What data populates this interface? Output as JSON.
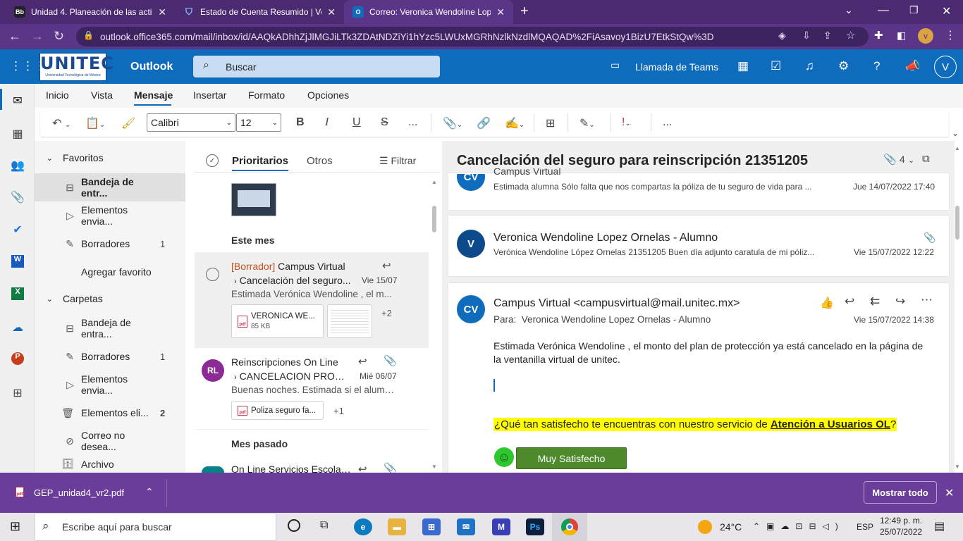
{
  "browser": {
    "tabs": [
      {
        "favicon": "Bb",
        "title": "Unidad 4. Planeación de las activ"
      },
      {
        "favicon": "shield",
        "title": "Estado de Cuenta Resumido | Ver"
      },
      {
        "favicon": "O",
        "title": "Correo: Veronica Wendoline Lop"
      }
    ],
    "new_tab": "+",
    "url": "outlook.office365.com/mail/inbox/id/AAQkADhhZjJlMGJiLTk3ZDAtNDZiYi1hYzc5LWUxMGRhNzlkNzdlMQAQAD%2FiAsavoy1BizU7EtkStQw%3D",
    "profile_initial": "v"
  },
  "outlook": {
    "logo_text": "UNITEC",
    "logo_sub": "Universidad Tecnológica de México",
    "app_name": "Outlook",
    "search_placeholder": "Buscar",
    "teams_call": "Llamada de Teams",
    "avatar": "V"
  },
  "ribbon": {
    "tabs": [
      "Inicio",
      "Vista",
      "Mensaje",
      "Insertar",
      "Formato",
      "Opciones"
    ],
    "active_tab": "Mensaje",
    "font_name": "Calibri",
    "font_size": "12",
    "more": "...",
    "more2": "..."
  },
  "folders": {
    "favoritos_label": "Favoritos",
    "favoritos": [
      {
        "label": "Bandeja de entr...",
        "count": "",
        "icon": "inbox-icon"
      },
      {
        "label": "Elementos envia...",
        "count": "",
        "icon": "send-icon"
      },
      {
        "label": "Borradores",
        "count": "1",
        "icon": "draft-icon"
      },
      {
        "label": "Agregar favorito",
        "count": "",
        "icon": ""
      }
    ],
    "carpetas_label": "Carpetas",
    "carpetas": [
      {
        "label": "Bandeja de entra...",
        "count": "",
        "icon": "inbox-icon"
      },
      {
        "label": "Borradores",
        "count": "1",
        "icon": "draft-icon"
      },
      {
        "label": "Elementos envia...",
        "count": "",
        "icon": "send-icon"
      },
      {
        "label": "Elementos eli...",
        "count": "2",
        "icon": "trash-icon"
      },
      {
        "label": "Correo no desea...",
        "count": "",
        "icon": "junk-icon"
      },
      {
        "label": "Archivo",
        "count": "",
        "icon": "archive-icon"
      }
    ]
  },
  "message_list": {
    "tab_focused": "Prioritarios",
    "tab_other": "Otros",
    "filter": "Filtrar",
    "section_this_month": "Este mes",
    "section_last_month": "Mes pasado",
    "items": [
      {
        "draft_tag": "[Borrador]",
        "sender": "Campus Virtual",
        "subject": "Cancelación del seguro...",
        "date": "Vie 15/07",
        "preview": "Estimada Verónica Wendoline , el m...",
        "attachment": "VERONICA WE...",
        "attachment_size": "85 KB",
        "more_attachments": "+2"
      },
      {
        "initials": "RL",
        "sender": "Reinscripciones On Line",
        "subject": "CANCELACION PROTE...",
        "date": "Mié 06/07",
        "preview": "Buenas noches. Estimada si el alumn...",
        "attachment": "Poliza seguro fa...",
        "more_attachments": "+1"
      },
      {
        "sender": "On Line Servicios Escolar..."
      }
    ]
  },
  "reading": {
    "subject": "Cancelación del seguro para reinscripción 21351205",
    "attachment_count": "4",
    "messages": [
      {
        "initials": "CV",
        "sender": "Campus Virtual",
        "preview": "Estimada alumna Sólo falta que nos compartas la póliza de tu seguro de vida para ...",
        "date": "Jue 14/07/2022 17:40"
      },
      {
        "initials": "V",
        "sender": "Veronica Wendoline Lopez Ornelas - Alumno",
        "preview": "Verónica Wendoline López Ornelas 21351205 Buen día adjunto caratula de mi póliz...",
        "date": "Vie 15/07/2022 12:22"
      }
    ],
    "open": {
      "initials": "CV",
      "sender": "Campus Virtual <campusvirtual@mail.unitec.mx>",
      "to_label": "Para:",
      "to": "Veronica Wendoline Lopez Ornelas - Alumno",
      "date": "Vie 15/07/2022 14:38",
      "body": "Estimada Verónica Wendoline , el monto del plan de protección ya está cancelado en la página de la ventanilla virtual de unitec.",
      "survey_pre": "¿Qué tan satisfecho te encuentras con nuestro servicio de ",
      "survey_link": "Atención a Usuarios OL",
      "survey_post": "?",
      "button": "Muy Satisfecho"
    }
  },
  "download_bar": {
    "file": "GEP_unidad4_vr2.pdf",
    "show_all": "Mostrar todo"
  },
  "taskbar": {
    "search": "Escribe aquí para buscar",
    "temp": "24°C",
    "lang": "ESP",
    "time": "12:49 p. m.",
    "date": "25/07/2022"
  },
  "colors": {
    "chrome_dark": "#4b2a72",
    "chrome": "#5b3587",
    "outlook_blue": "#0f6cbd",
    "download_bar": "#6a3d9a",
    "draft": "#c4501b",
    "survey_highlight": "#ffff00",
    "button_green": "#4e8a2c"
  }
}
